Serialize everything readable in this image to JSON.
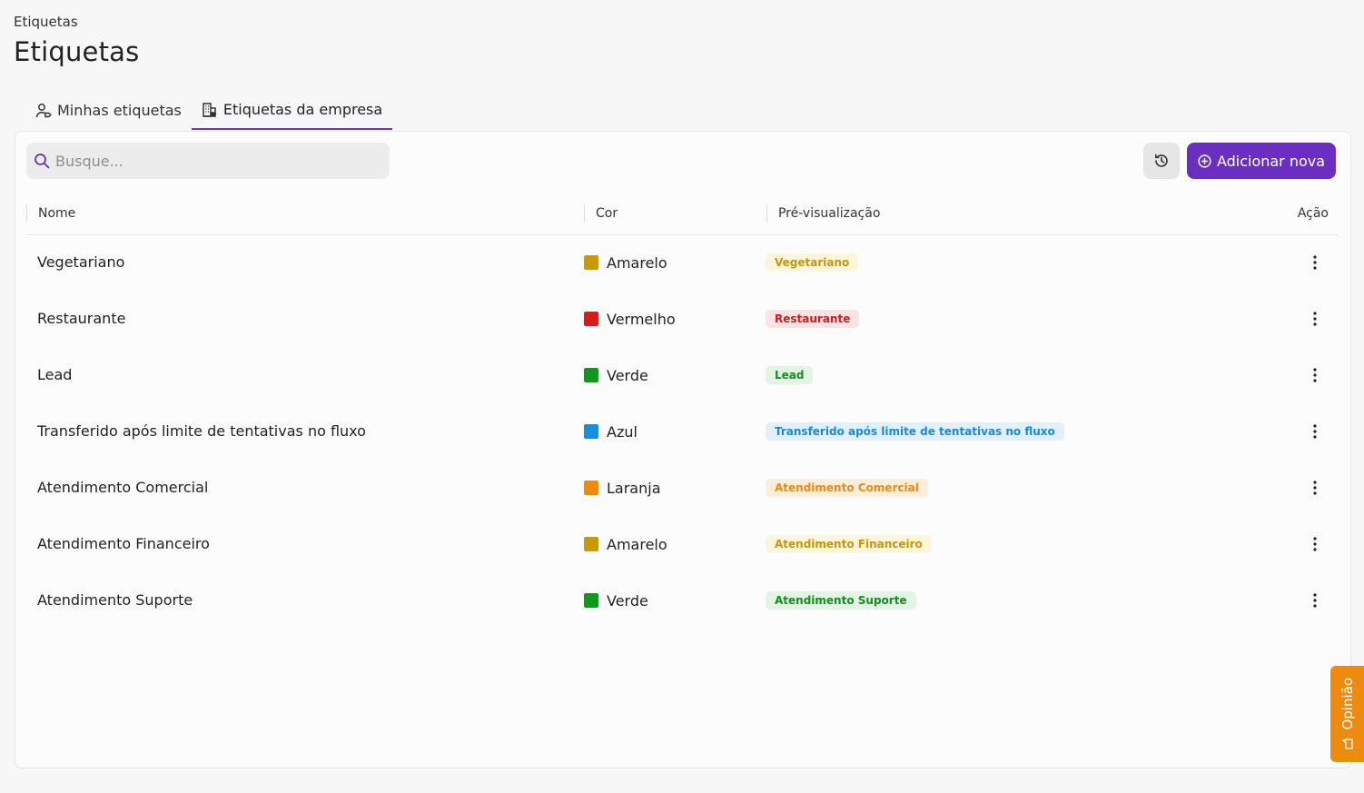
{
  "breadcrumb": "Etiquetas",
  "page_title": "Etiquetas",
  "tabs": [
    {
      "label": "Minhas etiquetas",
      "icon": "user-tag-icon",
      "active": false
    },
    {
      "label": "Etiquetas da empresa",
      "icon": "building-icon",
      "active": true
    }
  ],
  "search": {
    "placeholder": "Busque...",
    "value": ""
  },
  "toolbar": {
    "history_icon": "history-icon",
    "add_label": "Adicionar nova",
    "add_icon": "plus-circle-icon"
  },
  "table": {
    "headers": {
      "name": "Nome",
      "color": "Cor",
      "preview": "Pré-visualização",
      "action": "Ação"
    },
    "rows": [
      {
        "name": "Vegetariano",
        "color_name": "Amarelo",
        "swatch": "#c89a0a",
        "chip_text": "#c8960c",
        "chip_bg": "#fdf5dc",
        "preview": "Vegetariano"
      },
      {
        "name": "Restaurante",
        "color_name": "Vermelho",
        "swatch": "#d81b1b",
        "chip_text": "#c81e1e",
        "chip_bg": "#fbe3e3",
        "preview": "Restaurante"
      },
      {
        "name": "Lead",
        "color_name": "Verde",
        "swatch": "#13961e",
        "chip_text": "#178c22",
        "chip_bg": "#e3f4e4",
        "preview": "Lead"
      },
      {
        "name": "Transferido após limite de tentativas no fluxo",
        "color_name": "Azul",
        "swatch": "#1a8fd8",
        "chip_text": "#1a8ad6",
        "chip_bg": "#e1f0fb",
        "preview": "Transferido após limite de tentativas no fluxo"
      },
      {
        "name": "Atendimento Comercial",
        "color_name": "Laranja",
        "swatch": "#f08a0c",
        "chip_text": "#ea8a18",
        "chip_bg": "#fdeedc",
        "preview": "Atendimento Comercial"
      },
      {
        "name": "Atendimento Financeiro",
        "color_name": "Amarelo",
        "swatch": "#c89a0a",
        "chip_text": "#c8960c",
        "chip_bg": "#fdf5dc",
        "preview": "Atendimento Financeiro"
      },
      {
        "name": "Atendimento Suporte",
        "color_name": "Verde",
        "swatch": "#13961e",
        "chip_text": "#178c22",
        "chip_bg": "#e3f4e4",
        "preview": "Atendimento Suporte"
      }
    ]
  },
  "feedback": {
    "label": "Opinião",
    "icon": "chat-icon"
  },
  "colors": {
    "accent": "#6a2fc0",
    "feedback": "#ef8a10"
  }
}
